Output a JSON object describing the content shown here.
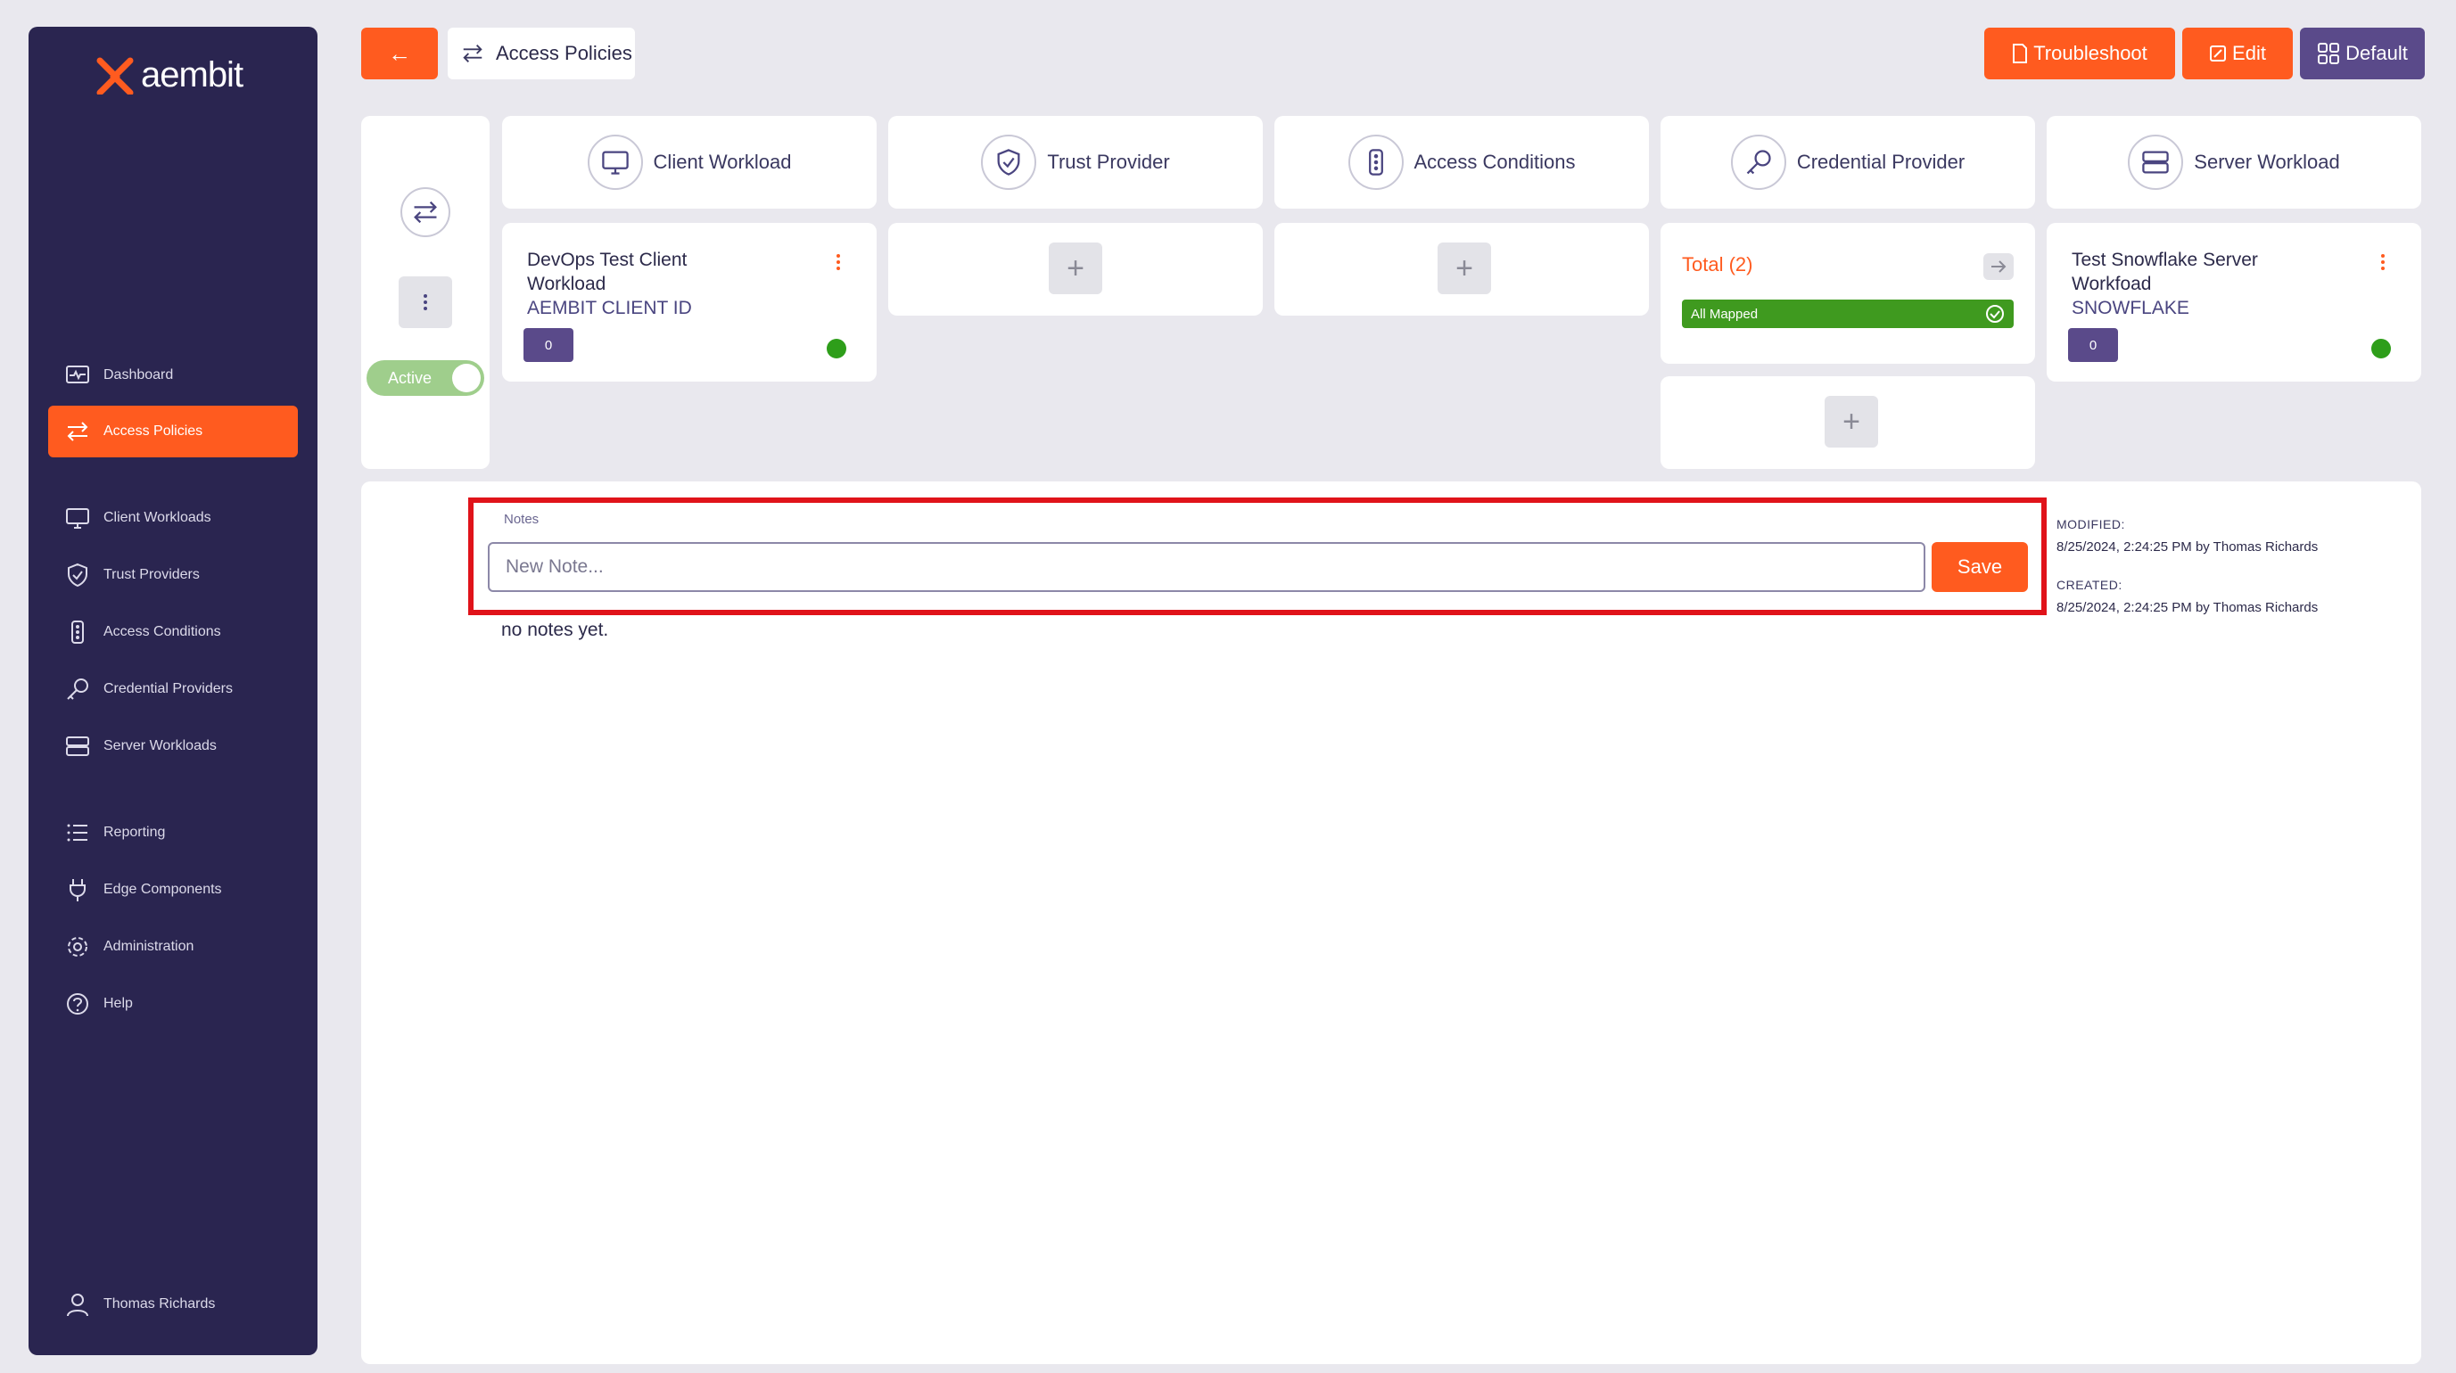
{
  "brand": {
    "logo_text": "aembit",
    "accent": "#ff5b1f",
    "sidebar_bg": "#2a2550",
    "purple": "#5a4a8a"
  },
  "sidebar": {
    "items": [
      {
        "label": "Dashboard",
        "icon": "dashboard-icon"
      },
      {
        "label": "Access Policies",
        "icon": "swap-arrows-icon",
        "active": true
      },
      {
        "label": "Client Workloads",
        "icon": "monitor-icon"
      },
      {
        "label": "Trust Providers",
        "icon": "shield-check-icon"
      },
      {
        "label": "Access Conditions",
        "icon": "traffic-light-icon"
      },
      {
        "label": "Credential Providers",
        "icon": "key-icon"
      },
      {
        "label": "Server Workloads",
        "icon": "server-icon"
      },
      {
        "label": "Reporting",
        "icon": "list-icon"
      },
      {
        "label": "Edge Components",
        "icon": "plug-icon"
      },
      {
        "label": "Administration",
        "icon": "gear-icon"
      },
      {
        "label": "Help",
        "icon": "help-circle-icon"
      }
    ],
    "user": "Thomas Richards"
  },
  "topbar": {
    "back_icon": "←",
    "breadcrumb": "Access Policies",
    "troubleshoot": "Troubleshoot",
    "edit": "Edit",
    "default": "Default"
  },
  "policy": {
    "status": "Active",
    "columns": {
      "client_workload": "Client Workload",
      "trust_provider": "Trust Provider",
      "access_conditions": "Access Conditions",
      "credential_provider": "Credential Provider",
      "server_workload": "Server Workload"
    },
    "client": {
      "name": "DevOps Test Client Workload",
      "type": "AEMBIT CLIENT ID",
      "count": "0"
    },
    "credential": {
      "total": "Total (2)",
      "mapped": "All Mapped"
    },
    "server": {
      "name": "Test Snowflake Server Workfoad",
      "type": "SNOWFLAKE",
      "count": "0"
    },
    "plus": "+"
  },
  "notes": {
    "label": "Notes",
    "placeholder": "New Note...",
    "save": "Save",
    "empty": "no notes yet.",
    "modified_label": "MODIFIED:",
    "modified": "8/25/2024, 2:24:25 PM by Thomas Richards",
    "created_label": "CREATED:",
    "created": "8/25/2024, 2:24:25 PM by Thomas Richards"
  }
}
